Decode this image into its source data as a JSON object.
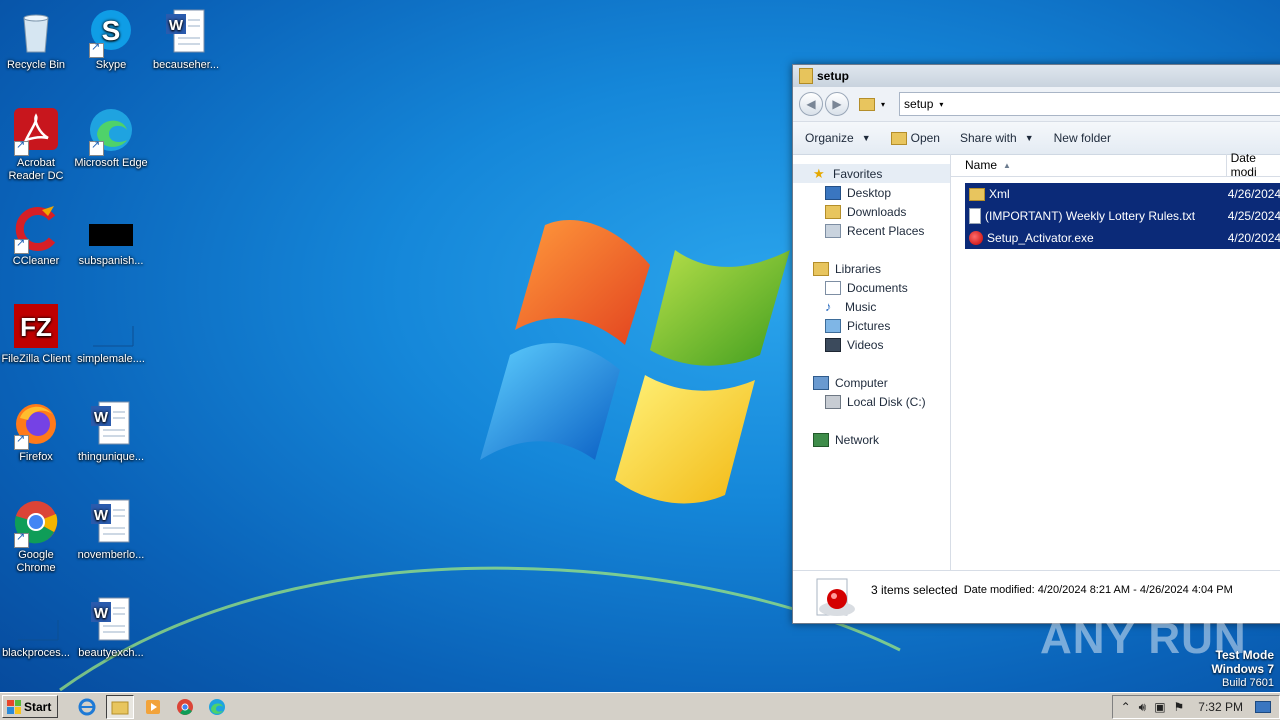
{
  "desktop": {
    "icons": [
      {
        "label": "Recycle Bin"
      },
      {
        "label": "Skype"
      },
      {
        "label": "becauseher..."
      },
      {
        "label": "Acrobat Reader DC"
      },
      {
        "label": "Microsoft Edge"
      },
      {
        "label": "CCleaner"
      },
      {
        "label": "subspanish..."
      },
      {
        "label": "FileZilla Client"
      },
      {
        "label": "simplemale...."
      },
      {
        "label": "Firefox"
      },
      {
        "label": "thingunique..."
      },
      {
        "label": "Google Chrome"
      },
      {
        "label": "novemberlo..."
      },
      {
        "label": "blackproces..."
      },
      {
        "label": "beautyexch..."
      }
    ]
  },
  "explorer": {
    "title": "setup",
    "address": "setup",
    "toolbar": {
      "organize": "Organize",
      "open": "Open",
      "share": "Share with",
      "new_folder": "New folder"
    },
    "nav": {
      "favorites": "Favorites",
      "desktop": "Desktop",
      "downloads": "Downloads",
      "recent": "Recent Places",
      "libraries": "Libraries",
      "documents": "Documents",
      "music": "Music",
      "pictures": "Pictures",
      "videos": "Videos",
      "computer": "Computer",
      "local_disk": "Local Disk (C:)",
      "network": "Network"
    },
    "columns": {
      "name": "Name",
      "date": "Date modi"
    },
    "files": [
      {
        "name": "Xml",
        "date": "4/26/2024"
      },
      {
        "name": "(IMPORTANT) Weekly Lottery Rules.txt",
        "date": "4/25/2024"
      },
      {
        "name": "Setup_Activator.exe",
        "date": "4/20/2024"
      }
    ],
    "details": {
      "selected": "3 items selected",
      "date_modified": "Date modified: 4/20/2024 8:21 AM - 4/26/2024 4:04 PM"
    }
  },
  "watermark": {
    "text": "ANY RUN"
  },
  "testmode": {
    "line1": "Test Mode",
    "line2": "Windows 7",
    "line3": "Build 7601"
  },
  "taskbar": {
    "start": "Start",
    "clock": "7:32 PM"
  }
}
